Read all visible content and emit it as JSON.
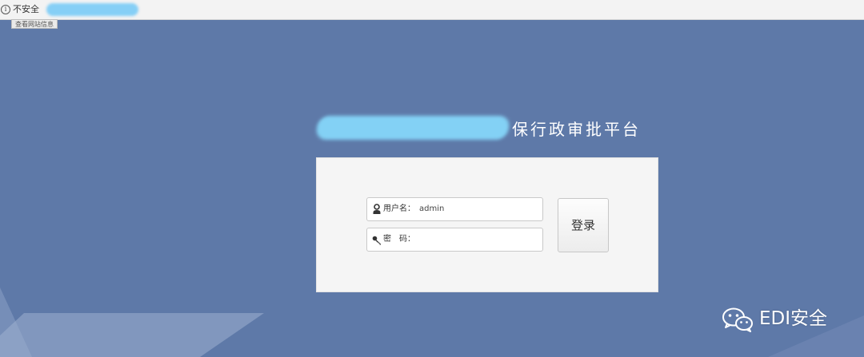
{
  "browser": {
    "security_label": "不安全",
    "tooltip": "查看网站信息",
    "info_icon": "info-icon"
  },
  "page": {
    "title_suffix": "保行政审批平台"
  },
  "login": {
    "username_label": "用户名：",
    "username_value": "admin",
    "password_label": "密　码：",
    "password_value": "",
    "submit_label": "登录",
    "username_icon": "user-icon",
    "password_icon": "key-icon"
  },
  "watermark": {
    "text": "EDI安全",
    "icon": "wechat-icon"
  },
  "colors": {
    "background": "#5e79a8",
    "panel": "#f5f5f5",
    "redaction": "#86cff6"
  }
}
